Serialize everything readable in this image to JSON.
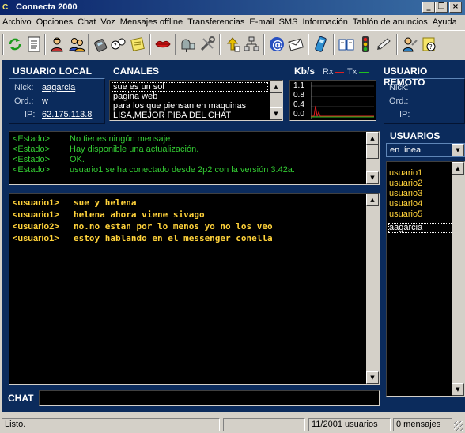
{
  "window": {
    "title": "Connecta 2000",
    "app_icon": "C"
  },
  "menu": [
    "Archivo",
    "Opciones",
    "Chat",
    "Voz",
    "Mensajes offline",
    "Transferencias",
    "E-mail",
    "SMS",
    "Información",
    "Tablón de anuncios",
    "Ayuda"
  ],
  "toolbar_icons": [
    "reconnect-icon",
    "document-icon",
    "user-info-icon",
    "users-icon",
    "phone-icon",
    "voice-chat-icon",
    "notes-icon",
    "lips-icon",
    "mailbox-icon",
    "tools-icon",
    "upload-icon",
    "network-icon",
    "email-at-icon",
    "mail-envelope-icon",
    "mobile-sms-icon",
    "bulletin-book-icon",
    "traffic-light-icon",
    "pen-icon",
    "help-person-icon",
    "about-icon"
  ],
  "local_user": {
    "heading": "USUARIO LOCAL",
    "nick_label": "Nick:",
    "nick": "aagarcia",
    "ord_label": "Ord.:",
    "ord": "w",
    "ip_label": "IP:",
    "ip": "62.175.113.8"
  },
  "channels": {
    "heading": "CANALES",
    "items": [
      "sue es un sol",
      "pagina web",
      "para los que piensan en maquinas",
      "LISA,MEJOR PIBA DEL CHAT"
    ]
  },
  "traffic": {
    "kbs_label": "Kb/s",
    "rx_label": "Rx",
    "tx_label": "Tx",
    "ticks": [
      "1.1",
      "0.8",
      "0.4",
      "0.0"
    ],
    "rx_color": "#e02020",
    "tx_color": "#20c020"
  },
  "remote_user": {
    "heading": "USUARIO REMOTO",
    "nick_label": "Nick:",
    "ord_label": "Ord.:",
    "ip_label": "IP:"
  },
  "status_log": [
    {
      "tag": "<Estado>",
      "text": "No tienes ningún mensaje."
    },
    {
      "tag": "<Estado>",
      "text": "Hay disponible una actualización."
    },
    {
      "tag": "<Estado>",
      "text": "OK."
    },
    {
      "tag": "<Estado>",
      "text": "usuario1 se ha conectado desde 2p2 con la versión 3.42a."
    }
  ],
  "chat_log": [
    {
      "who": "<usuario1>",
      "text": "sue y helena"
    },
    {
      "who": "<usuario1>",
      "text": "helena ahora viene sivago"
    },
    {
      "who": "<usuario2>",
      "text": "no.no estan por lo menos yo no los veo"
    },
    {
      "who": "<usuario1>",
      "text": "estoy hablando en el messenger conella"
    }
  ],
  "users": {
    "heading": "USUARIOS",
    "filter": "en línea",
    "items": [
      "usuario1",
      "usuario2",
      "usuario3",
      "usuario4",
      "usuario5"
    ],
    "self": "aagarcia"
  },
  "chat_input": {
    "label": "CHAT",
    "value": ""
  },
  "statusbar": {
    "status": "Listo.",
    "users": "11/2001 usuarios",
    "messages": "0 mensajes"
  },
  "colors": {
    "background": "#0b2b5c",
    "status_text": "#33cc33",
    "chat_text": "#ffd23a"
  }
}
